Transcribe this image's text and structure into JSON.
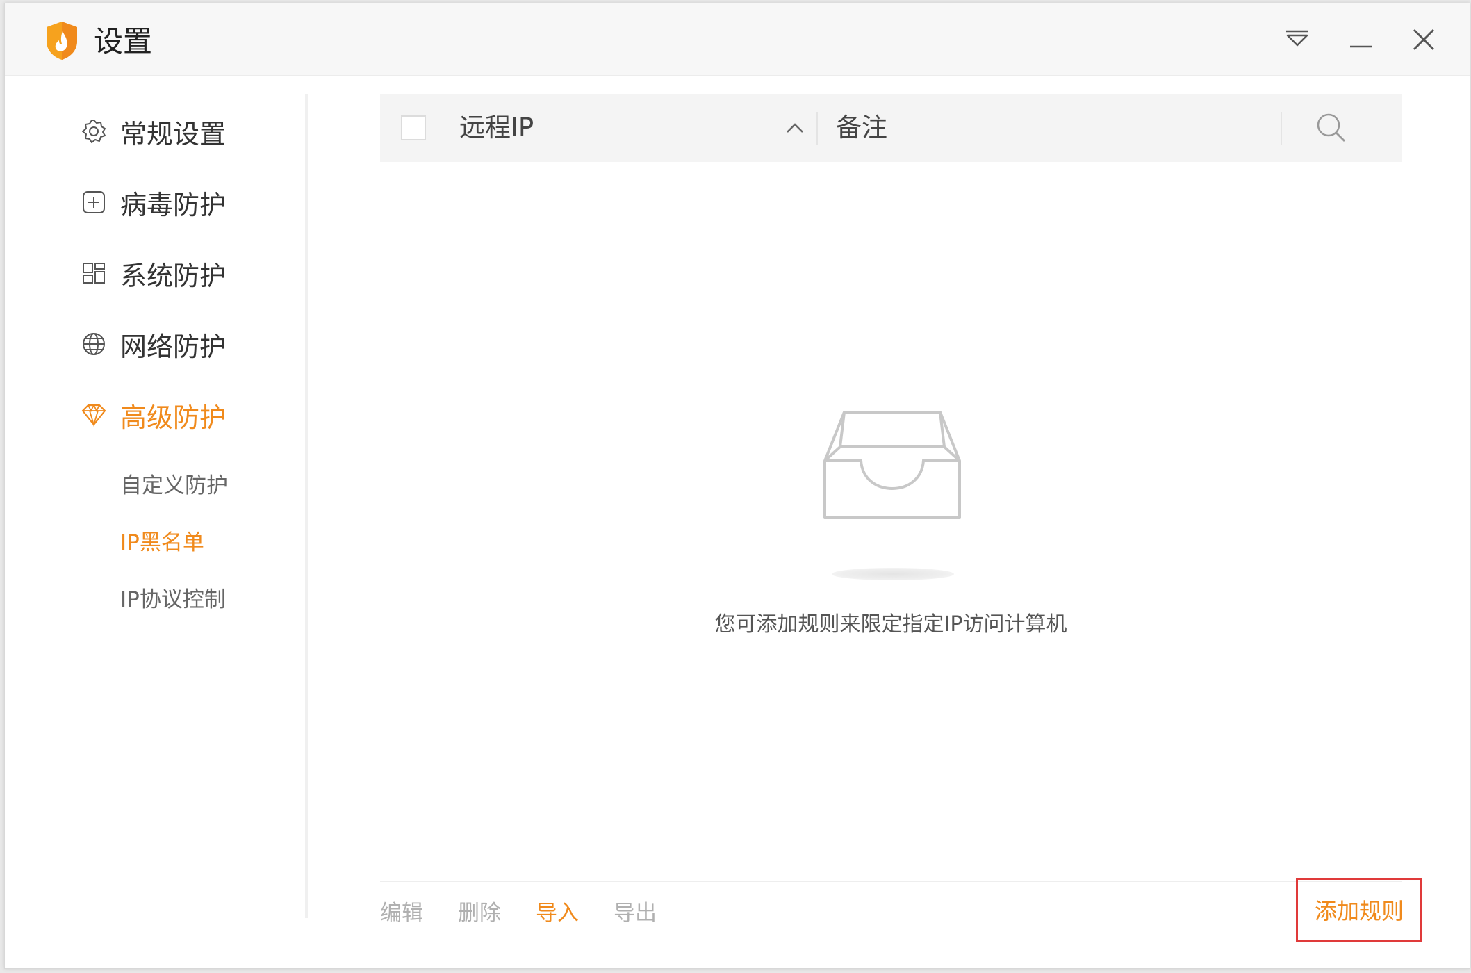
{
  "window": {
    "title": "设置"
  },
  "sidebar": {
    "items": [
      {
        "label": "常规设置",
        "icon": "gear-icon"
      },
      {
        "label": "病毒防护",
        "icon": "plus-box-icon"
      },
      {
        "label": "系统防护",
        "icon": "grid-icon"
      },
      {
        "label": "网络防护",
        "icon": "globe-icon"
      },
      {
        "label": "高级防护",
        "icon": "diamond-icon",
        "active": true
      }
    ],
    "sub_items": [
      {
        "label": "自定义防护"
      },
      {
        "label": "IP黑名单",
        "active": true
      },
      {
        "label": "IP协议控制"
      }
    ]
  },
  "table": {
    "columns": [
      "远程IP",
      "备注"
    ],
    "sort_column": "远程IP",
    "sort_direction": "ascending",
    "rows": []
  },
  "empty_state": {
    "message": "您可添加规则来限定指定IP访问计算机"
  },
  "footer": {
    "actions": [
      "编辑",
      "删除",
      "导入",
      "导出"
    ],
    "add_rule": "添加规则"
  },
  "colors": {
    "accent": "#f08a1c",
    "highlight_border": "#e03a3a"
  }
}
